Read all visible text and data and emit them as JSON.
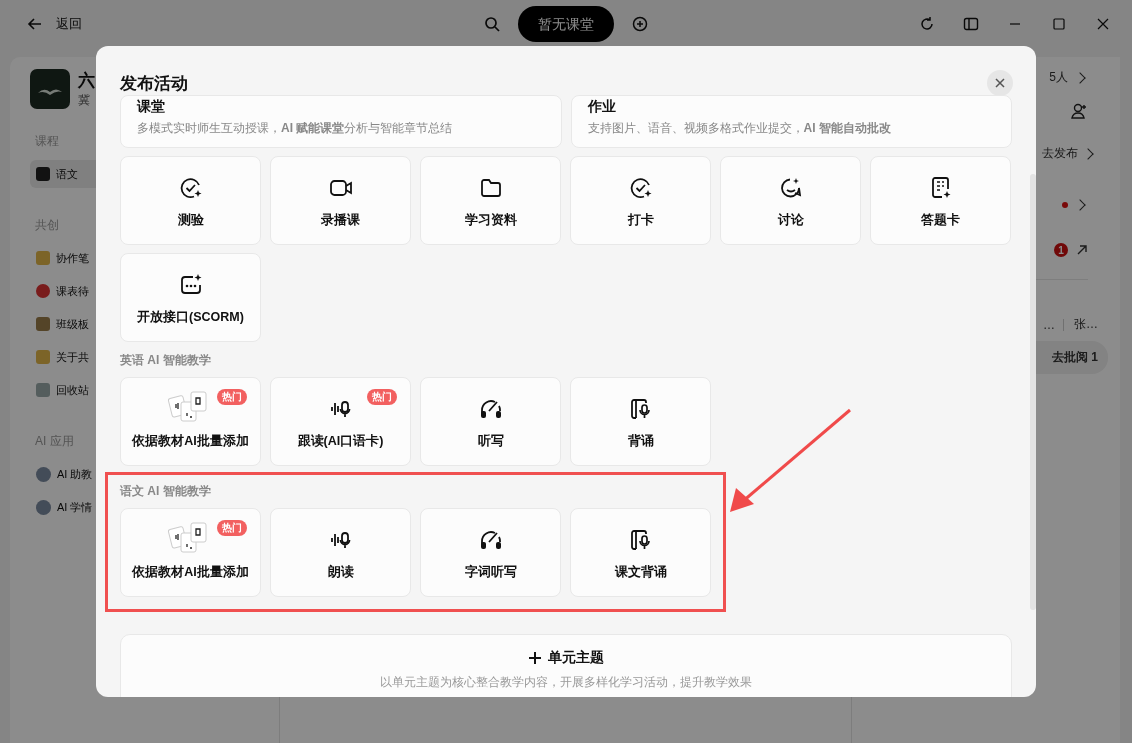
{
  "topbar": {
    "back_label": "返回",
    "classroom_pill": "暂无课堂"
  },
  "sidebar": {
    "course_title": "六",
    "course_subtitle": "冀",
    "sections": [
      {
        "heading": "课程",
        "items": [
          {
            "label": "语文",
            "selected": true
          }
        ]
      },
      {
        "heading": "共创",
        "items": [
          {
            "label": "协作笔",
            "selected": false
          },
          {
            "label": "课表待",
            "selected": false
          },
          {
            "label": "班级板",
            "selected": false
          },
          {
            "label": "关于共",
            "selected": false
          },
          {
            "label": "回收站",
            "selected": false
          }
        ]
      },
      {
        "heading": "AI 应用",
        "items": [
          {
            "label": "AI 助教",
            "selected": false
          },
          {
            "label": "AI 学情",
            "selected": false
          }
        ]
      }
    ]
  },
  "right_panel": {
    "member_count": "5人",
    "publish_link": "去发布",
    "unread_badge": "1",
    "text_fragment": "…",
    "name_fragment": "张…",
    "review_button": "去批阅 1"
  },
  "modal": {
    "title": "发布活动",
    "wide_cards": [
      {
        "title": "课堂",
        "description": "多模式实时师生互动授课，**AI 赋能课堂**分析与智能章节总结"
      },
      {
        "title": "作业",
        "description": "支持图片、语音、视频多格式作业提交，**AI 智能自动批改**"
      }
    ],
    "groups": [
      {
        "items": [
          {
            "kind": "quiz",
            "label": "测验"
          },
          {
            "kind": "video",
            "label": "录播课"
          },
          {
            "kind": "folder",
            "label": "学习资料"
          },
          {
            "kind": "quiz",
            "label": "打卡"
          },
          {
            "kind": "discussion",
            "label": "讨论"
          },
          {
            "kind": "sheet",
            "label": "答题卡"
          },
          {
            "kind": "scorm",
            "label": "开放接口(SCORM)"
          }
        ]
      },
      {
        "heading": "英语 AI 智能教学",
        "highlighted": false,
        "items": [
          {
            "kind": "batch",
            "label": "依据教材AI批量添加",
            "badge": "热门"
          },
          {
            "kind": "voice",
            "label": "跟读(AI口语卡)",
            "badge": "热门"
          },
          {
            "kind": "dictation",
            "label": "听写"
          },
          {
            "kind": "recite",
            "label": "背诵"
          }
        ]
      },
      {
        "heading": "语文 AI 智能教学",
        "highlighted": true,
        "items": [
          {
            "kind": "batch",
            "label": "依据教材AI批量添加",
            "badge": "热门"
          },
          {
            "kind": "voice",
            "label": "朗读"
          },
          {
            "kind": "dictation",
            "label": "字词听写"
          },
          {
            "kind": "recite",
            "label": "课文背诵"
          }
        ]
      }
    ],
    "unit_card": {
      "title": "单元主题",
      "description": "以单元主题为核心整合教学内容，开展多样化学习活动，提升教学效果"
    }
  }
}
